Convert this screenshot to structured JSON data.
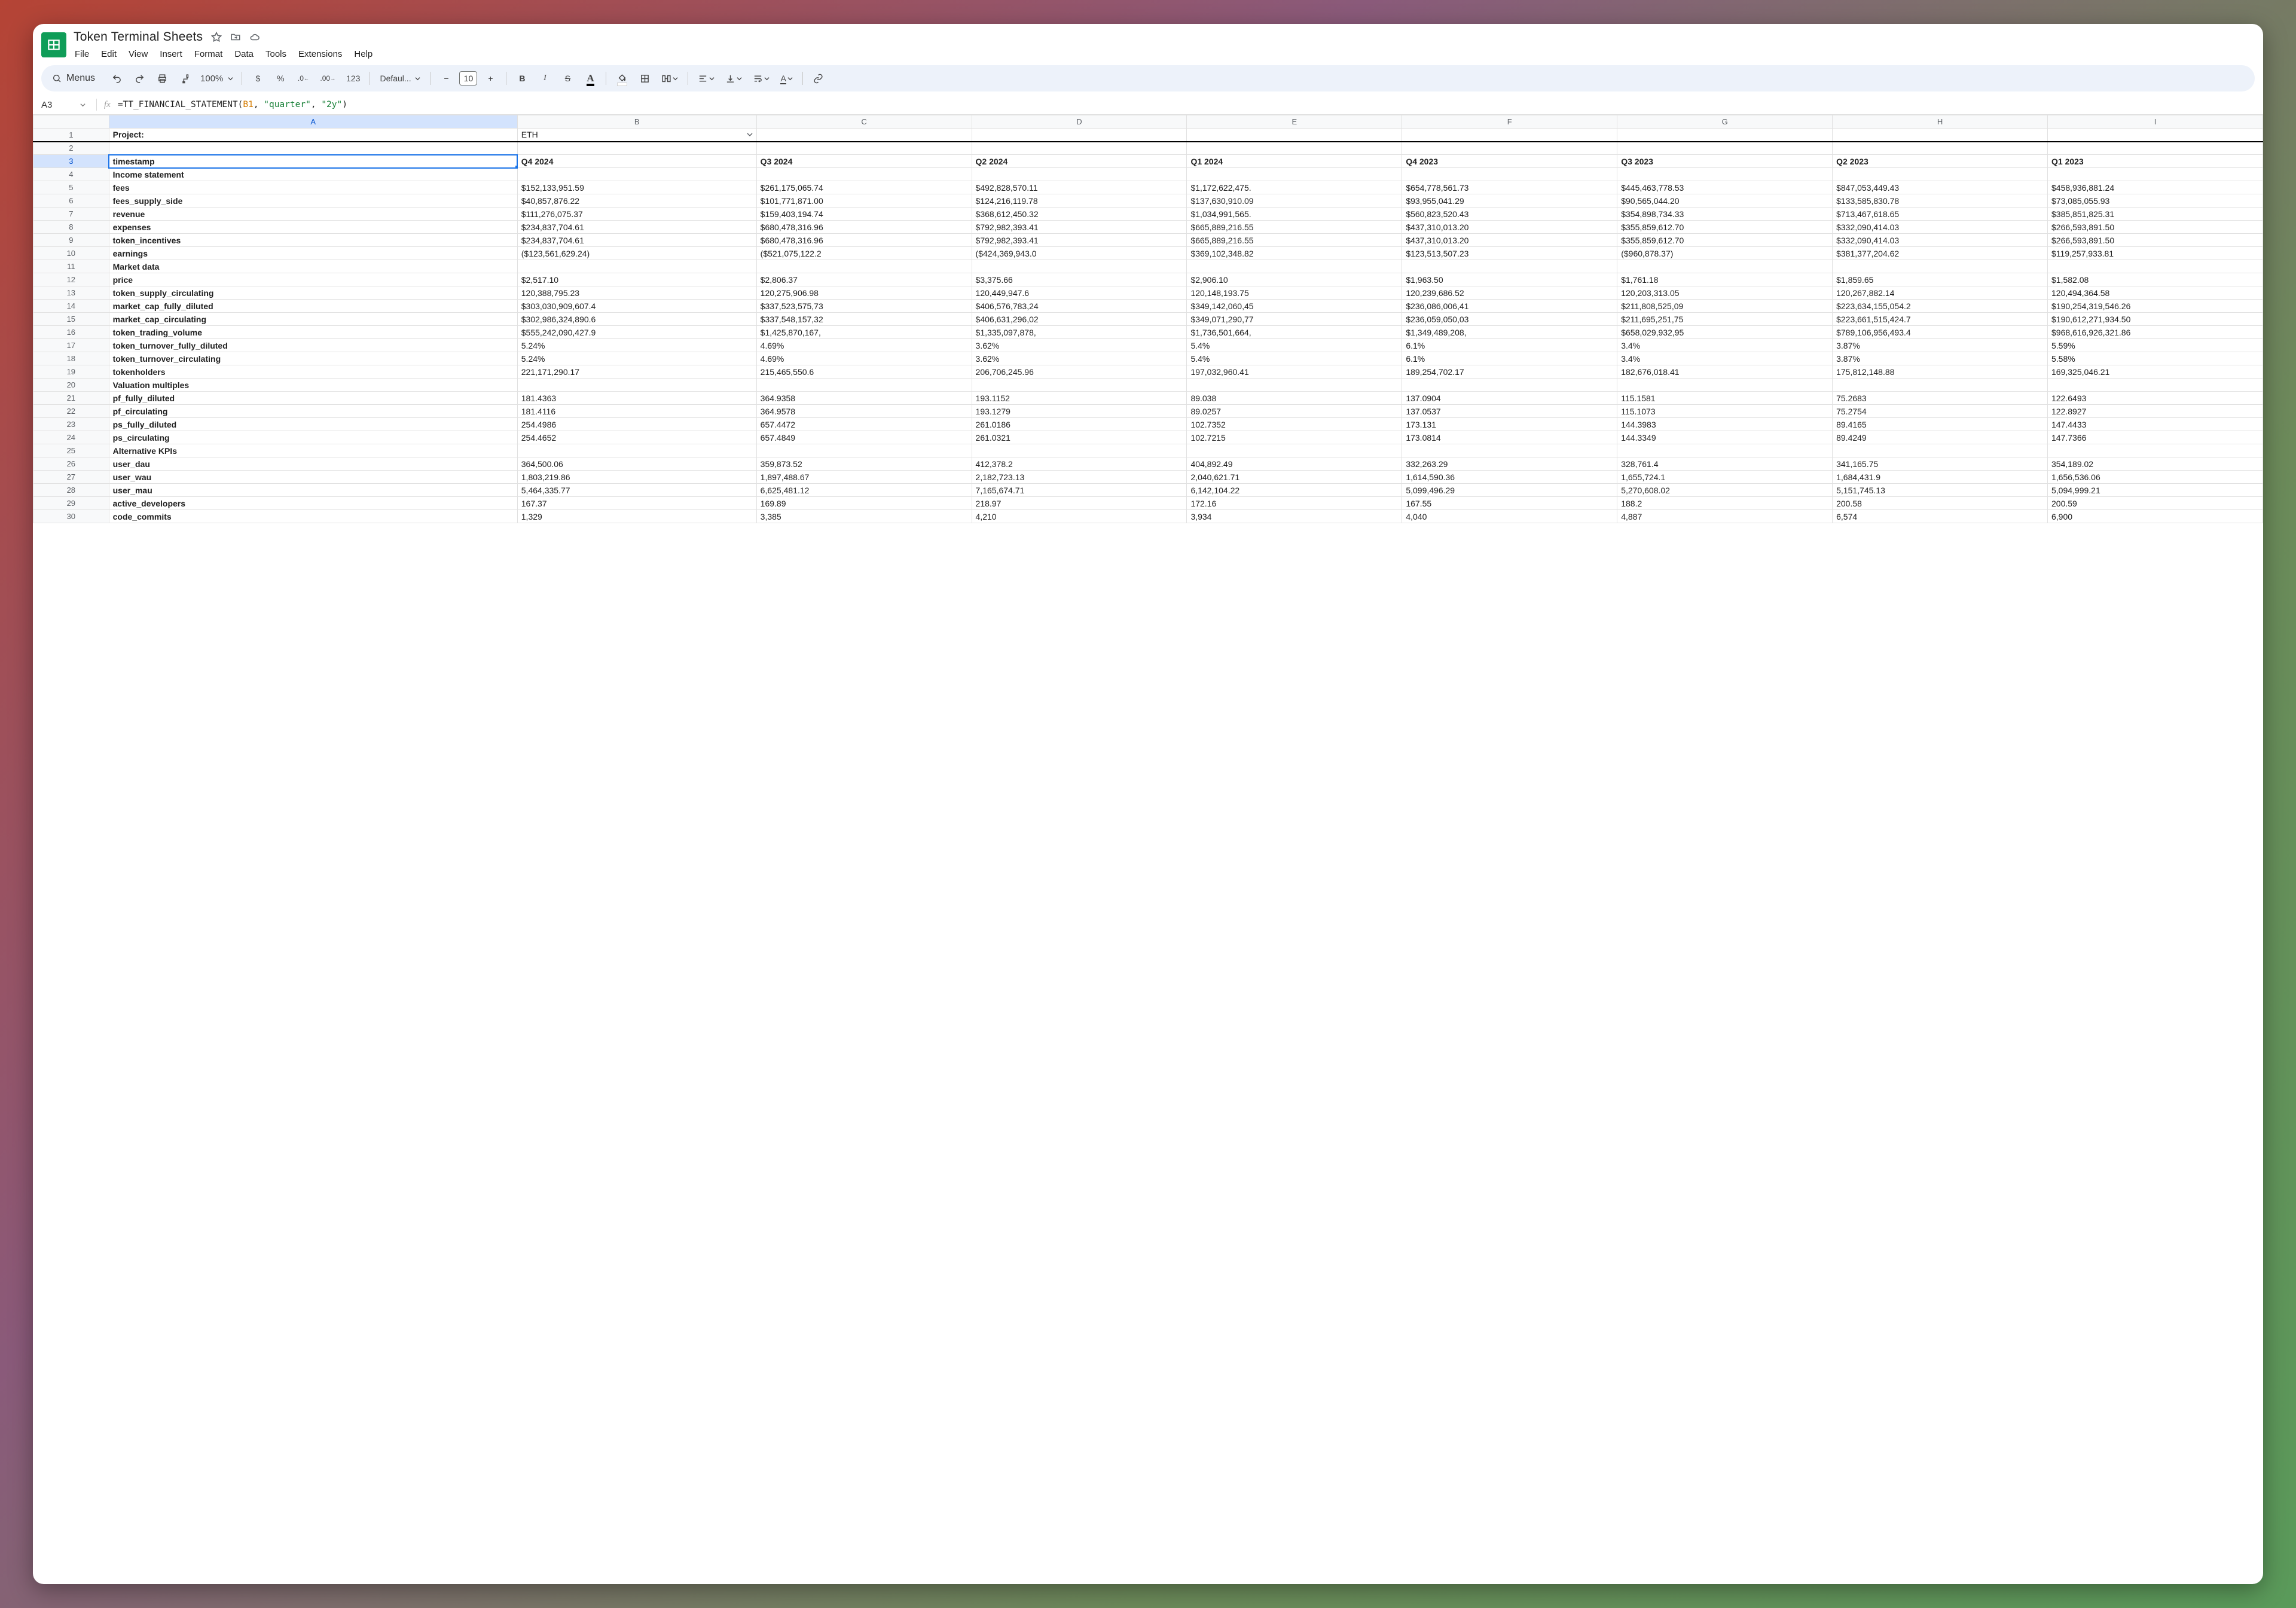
{
  "doc": {
    "title": "Token Terminal Sheets",
    "menus_label": "Menus"
  },
  "menubar": [
    "File",
    "Edit",
    "View",
    "Insert",
    "Format",
    "Data",
    "Tools",
    "Extensions",
    "Help"
  ],
  "toolbar": {
    "zoom": "100%",
    "font_family": "Defaul...",
    "font_size": "10"
  },
  "namebox": "A3",
  "formula": {
    "raw": "=TT_FINANCIAL_STATEMENT(B1, \"quarter\", \"2y\")",
    "fn": "=TT_FINANCIAL_STATEMENT(",
    "ref": "B1",
    "mid": ", ",
    "str1": "\"quarter\"",
    "mid2": ", ",
    "str2": "\"2y\"",
    "close": ")"
  },
  "columns": [
    "A",
    "B",
    "C",
    "D",
    "E",
    "F",
    "G",
    "H",
    "I"
  ],
  "project_label": "Project:",
  "project_value": "ETH",
  "quarters": [
    "Q4 2024",
    "Q3 2024",
    "Q2 2024",
    "Q1 2024",
    "Q4 2023",
    "Q3 2023",
    "Q2 2023",
    "Q1 2023"
  ],
  "sections": {
    "income": "Income statement",
    "market": "Market data",
    "valuation": "Valuation multiples",
    "kpis": "Alternative KPIs"
  },
  "rows": [
    {
      "k": "timestamp",
      "bold": true,
      "t": "header"
    },
    {
      "k": "Income statement",
      "bold": true,
      "t": "section"
    },
    {
      "k": "fees",
      "bold": true,
      "v": [
        "$152,133,951.59",
        "$261,175,065.74",
        "$492,828,570.11",
        "$1,172,622,475.",
        "$654,778,561.73",
        "$445,463,778.53",
        "$847,053,449.43",
        "$458,936,881.24"
      ]
    },
    {
      "k": "fees_supply_side",
      "bold": true,
      "v": [
        "$40,857,876.22",
        "$101,771,871.00",
        "$124,216,119.78",
        "$137,630,910.09",
        "$93,955,041.29",
        "$90,565,044.20",
        "$133,585,830.78",
        "$73,085,055.93"
      ]
    },
    {
      "k": "revenue",
      "bold": true,
      "v": [
        "$111,276,075.37",
        "$159,403,194.74",
        "$368,612,450.32",
        "$1,034,991,565.",
        "$560,823,520.43",
        "$354,898,734.33",
        "$713,467,618.65",
        "$385,851,825.31"
      ]
    },
    {
      "k": "expenses",
      "bold": true,
      "v": [
        "$234,837,704.61",
        "$680,478,316.96",
        "$792,982,393.41",
        "$665,889,216.55",
        "$437,310,013.20",
        "$355,859,612.70",
        "$332,090,414.03",
        "$266,593,891.50"
      ]
    },
    {
      "k": "token_incentives",
      "bold": true,
      "v": [
        "$234,837,704.61",
        "$680,478,316.96",
        "$792,982,393.41",
        "$665,889,216.55",
        "$437,310,013.20",
        "$355,859,612.70",
        "$332,090,414.03",
        "$266,593,891.50"
      ]
    },
    {
      "k": "earnings",
      "bold": true,
      "v": [
        "($123,561,629.24)",
        "($521,075,122.2",
        "($424,369,943.0",
        "$369,102,348.82",
        "$123,513,507.23",
        "($960,878.37)",
        "$381,377,204.62",
        "$119,257,933.81"
      ]
    },
    {
      "k": "Market data",
      "bold": true,
      "t": "section"
    },
    {
      "k": "price",
      "bold": true,
      "v": [
        "$2,517.10",
        "$2,806.37",
        "$3,375.66",
        "$2,906.10",
        "$1,963.50",
        "$1,761.18",
        "$1,859.65",
        "$1,582.08"
      ]
    },
    {
      "k": "token_supply_circulating",
      "bold": true,
      "v": [
        "120,388,795.23",
        "120,275,906.98",
        "120,449,947.6",
        "120,148,193.75",
        "120,239,686.52",
        "120,203,313.05",
        "120,267,882.14",
        "120,494,364.58"
      ]
    },
    {
      "k": "market_cap_fully_diluted",
      "bold": true,
      "v": [
        "$303,030,909,607.4",
        "$337,523,575,73",
        "$406,576,783,24",
        "$349,142,060,45",
        "$236,086,006,41",
        "$211,808,525,09",
        "$223,634,155,054.2",
        "$190,254,319,546.26"
      ]
    },
    {
      "k": "market_cap_circulating",
      "bold": true,
      "v": [
        "$302,986,324,890.6",
        "$337,548,157,32",
        "$406,631,296,02",
        "$349,071,290,77",
        "$236,059,050,03",
        "$211,695,251,75",
        "$223,661,515,424.7",
        "$190,612,271,934.50"
      ]
    },
    {
      "k": "token_trading_volume",
      "bold": true,
      "v": [
        "$555,242,090,427.9",
        "$1,425,870,167,",
        "$1,335,097,878,",
        "$1,736,501,664,",
        "$1,349,489,208,",
        "$658,029,932,95",
        "$789,106,956,493.4",
        "$968,616,926,321.86"
      ]
    },
    {
      "k": "token_turnover_fully_diluted",
      "bold": true,
      "v": [
        "5.24%",
        "4.69%",
        "3.62%",
        "5.4%",
        "6.1%",
        "3.4%",
        "3.87%",
        "5.59%"
      ]
    },
    {
      "k": "token_turnover_circulating",
      "bold": true,
      "v": [
        "5.24%",
        "4.69%",
        "3.62%",
        "5.4%",
        "6.1%",
        "3.4%",
        "3.87%",
        "5.58%"
      ]
    },
    {
      "k": "tokenholders",
      "bold": true,
      "v": [
        "221,171,290.17",
        "215,465,550.6",
        "206,706,245.96",
        "197,032,960.41",
        "189,254,702.17",
        "182,676,018.41",
        "175,812,148.88",
        "169,325,046.21"
      ]
    },
    {
      "k": "Valuation multiples",
      "bold": true,
      "t": "section"
    },
    {
      "k": "pf_fully_diluted",
      "bold": true,
      "v": [
        "181.4363",
        "364.9358",
        "193.1152",
        "89.038",
        "137.0904",
        "115.1581",
        "75.2683",
        "122.6493"
      ]
    },
    {
      "k": "pf_circulating",
      "bold": true,
      "v": [
        "181.4116",
        "364.9578",
        "193.1279",
        "89.0257",
        "137.0537",
        "115.1073",
        "75.2754",
        "122.8927"
      ]
    },
    {
      "k": "ps_fully_diluted",
      "bold": true,
      "v": [
        "254.4986",
        "657.4472",
        "261.0186",
        "102.7352",
        "173.131",
        "144.3983",
        "89.4165",
        "147.4433"
      ]
    },
    {
      "k": "ps_circulating",
      "bold": true,
      "v": [
        "254.4652",
        "657.4849",
        "261.0321",
        "102.7215",
        "173.0814",
        "144.3349",
        "89.4249",
        "147.7366"
      ]
    },
    {
      "k": "Alternative KPIs",
      "bold": true,
      "t": "section"
    },
    {
      "k": "user_dau",
      "bold": true,
      "v": [
        "364,500.06",
        "359,873.52",
        "412,378.2",
        "404,892.49",
        "332,263.29",
        "328,761.4",
        "341,165.75",
        "354,189.02"
      ]
    },
    {
      "k": "user_wau",
      "bold": true,
      "v": [
        "1,803,219.86",
        "1,897,488.67",
        "2,182,723.13",
        "2,040,621.71",
        "1,614,590.36",
        "1,655,724.1",
        "1,684,431.9",
        "1,656,536.06"
      ]
    },
    {
      "k": "user_mau",
      "bold": true,
      "v": [
        "5,464,335.77",
        "6,625,481.12",
        "7,165,674.71",
        "6,142,104.22",
        "5,099,496.29",
        "5,270,608.02",
        "5,151,745.13",
        "5,094,999.21"
      ]
    },
    {
      "k": "active_developers",
      "bold": true,
      "v": [
        "167.37",
        "169.89",
        "218.97",
        "172.16",
        "167.55",
        "188.2",
        "200.58",
        "200.59"
      ]
    },
    {
      "k": "code_commits",
      "bold": true,
      "v": [
        "1,329",
        "3,385",
        "4,210",
        "3,934",
        "4,040",
        "4,887",
        "6,574",
        "6,900"
      ]
    }
  ]
}
